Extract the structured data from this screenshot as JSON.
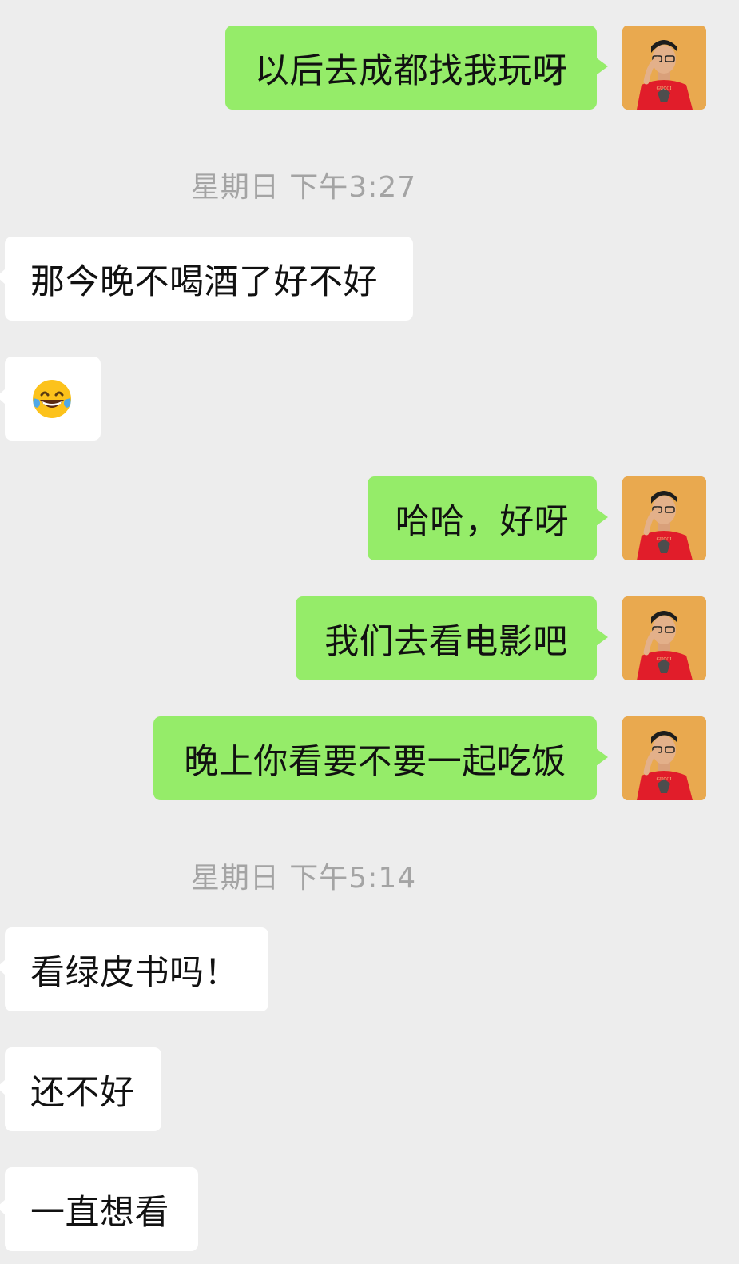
{
  "messages": [
    {
      "side": "sent",
      "text": "以后去成都找我玩呀"
    },
    {
      "side": "time",
      "text": "星期日 下午3:27"
    },
    {
      "side": "recv",
      "text": "那今晚不喝酒了好不好"
    },
    {
      "side": "recv",
      "emoji": "face-with-tears-of-joy-emoji"
    },
    {
      "side": "sent",
      "text": "哈哈，好呀"
    },
    {
      "side": "sent",
      "text": "我们去看电影吧"
    },
    {
      "side": "sent",
      "text": "晚上你看要不要一起吃饭"
    },
    {
      "side": "time",
      "text": "星期日 下午5:14"
    },
    {
      "side": "recv",
      "text": "看绿皮书吗！"
    },
    {
      "side": "recv",
      "text": "还不好"
    },
    {
      "side": "recv",
      "text": "一直想看"
    }
  ],
  "avatar": {
    "icon": "user-avatar",
    "shirt_text": "GUCCI"
  },
  "colors": {
    "background": "#ededed",
    "sent_bubble": "#95ec69",
    "received_bubble": "#ffffff",
    "timestamp": "#a4a4a4"
  }
}
